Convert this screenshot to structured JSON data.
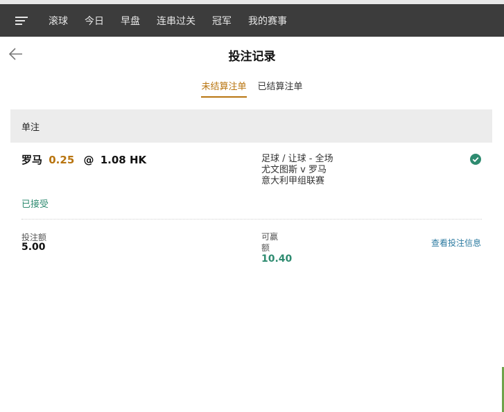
{
  "nav": {
    "items": [
      "滚球",
      "今日",
      "早盘",
      "连串过关",
      "冠军",
      "我的赛事"
    ]
  },
  "header": {
    "title": "投注记录"
  },
  "tabs": [
    {
      "label": "未结算注单",
      "active": true
    },
    {
      "label": "已结算注单",
      "active": false
    }
  ],
  "section": {
    "title": "单注"
  },
  "bet": {
    "selection": "罗马",
    "handicap": "0.25",
    "at": "@",
    "odds": "1.08 HK",
    "market": "足球 / 让球 - 全场",
    "match": "尤文图斯 v 罗马",
    "league": "意大利甲组联赛",
    "status": "已接受",
    "stake_label": "投注额",
    "stake_value": "5.00",
    "win_label": "可赢额",
    "win_value": "10.40",
    "detail_link": "查看投注信息"
  },
  "colors": {
    "accent": "#b8740f",
    "success": "#2e8b70",
    "link": "#2b7aa0",
    "navbar": "#3c3c3c"
  }
}
